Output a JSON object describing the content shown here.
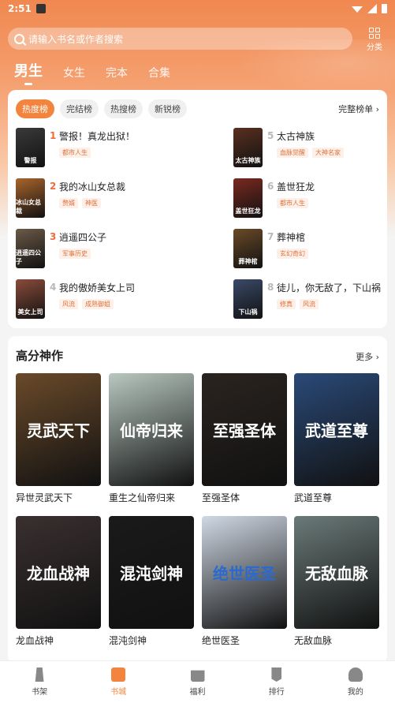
{
  "status": {
    "time": "2:51"
  },
  "search": {
    "placeholder": "请输入书名或作者搜索"
  },
  "category": {
    "label": "分类"
  },
  "gender_tabs": [
    {
      "label": "男生",
      "active": true
    },
    {
      "label": "女生"
    },
    {
      "label": "完本"
    },
    {
      "label": "合集"
    }
  ],
  "ranking": {
    "tabs": [
      {
        "label": "热度榜",
        "active": true
      },
      {
        "label": "完结榜"
      },
      {
        "label": "热搜榜"
      },
      {
        "label": "新锐榜"
      }
    ],
    "full_label": "完整榜单",
    "items": [
      {
        "rank": "1",
        "title": "警报！真龙出狱！",
        "tags": [
          "都市人生"
        ],
        "cover_text": "警报",
        "cover_color": "#3a3a3a"
      },
      {
        "rank": "2",
        "title": "我的冰山女总裁",
        "tags": [
          "赘婿",
          "神医"
        ],
        "cover_text": "冰山女总裁",
        "cover_color": "#a8642c"
      },
      {
        "rank": "3",
        "title": "逍遥四公子",
        "tags": [
          "军事历史"
        ],
        "cover_text": "逍遥四公子",
        "cover_color": "#6b5a48"
      },
      {
        "rank": "4",
        "title": "我的傲娇美女上司",
        "tags": [
          "风流",
          "成熟御姐"
        ],
        "cover_text": "美女上司",
        "cover_color": "#8a4c3a"
      },
      {
        "rank": "5",
        "title": "太古神族",
        "tags": [
          "血脉觉醒",
          "大神名家"
        ],
        "cover_text": "太古神族",
        "cover_color": "#5a3020"
      },
      {
        "rank": "6",
        "title": "盖世狂龙",
        "tags": [
          "都市人生"
        ],
        "cover_text": "盖世狂龙",
        "cover_color": "#7a2a20"
      },
      {
        "rank": "7",
        "title": "葬神棺",
        "tags": [
          "玄幻奇幻"
        ],
        "cover_text": "葬神棺",
        "cover_color": "#6a4a28"
      },
      {
        "rank": "8",
        "title": "徒儿，你无敌了，下山祸",
        "tags": [
          "修真",
          "风流"
        ],
        "cover_text": "下山祸",
        "cover_color": "#3a4a68"
      }
    ]
  },
  "high_score": {
    "title": "高分神作",
    "more_label": "更多",
    "books": [
      {
        "title": "异世灵武天下",
        "cover_text": "灵武天下",
        "cover_color": "#6a4a2a"
      },
      {
        "title": "重生之仙帝归来",
        "cover_text": "仙帝归来",
        "cover_color": "#b8c8c0"
      },
      {
        "title": "至强圣体",
        "cover_text": "至强圣体",
        "cover_color": "#2a2420"
      },
      {
        "title": "武道至尊",
        "cover_text": "武道至尊",
        "cover_color": "#2a4a78"
      },
      {
        "title": "龙血战神",
        "cover_text": "龙血战神",
        "cover_color": "#3a3030"
      },
      {
        "title": "混沌剑神",
        "cover_text": "混沌剑神",
        "cover_color": "#1a1a1a"
      },
      {
        "title": "绝世医圣",
        "cover_text": "绝世医圣",
        "cover_color": "#cfd8e4"
      },
      {
        "title": "无敌血脉",
        "cover_text": "无敌血脉",
        "cover_color": "#6a7a78"
      }
    ]
  },
  "bottom_nav": [
    {
      "label": "书架",
      "icon": "bookshelf-icon"
    },
    {
      "label": "书城",
      "icon": "bookstore-icon",
      "active": true
    },
    {
      "label": "福利",
      "icon": "gift-icon"
    },
    {
      "label": "排行",
      "icon": "ranking-icon"
    },
    {
      "label": "我的",
      "icon": "profile-icon"
    }
  ]
}
